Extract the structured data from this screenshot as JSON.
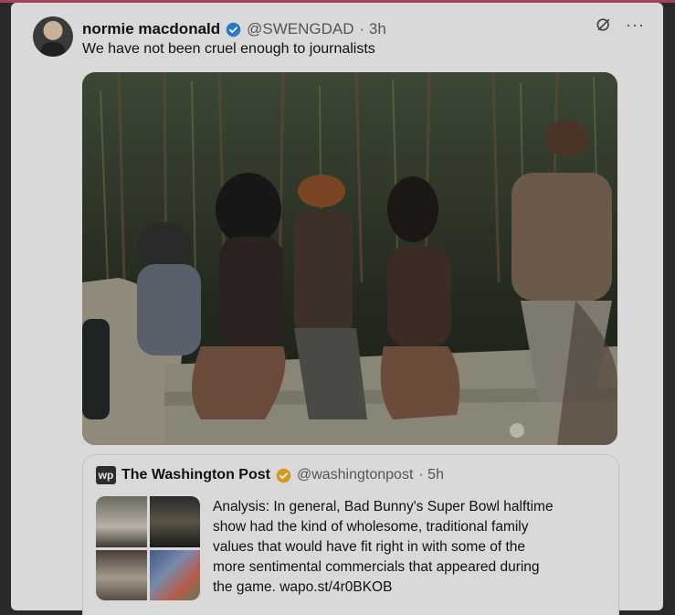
{
  "post": {
    "display_name": "normie macdonald",
    "handle": "@SWENGDAD",
    "time": "· 3h",
    "text": "We have not been cruel enough to journalists",
    "icons": [
      "verified-badge-icon",
      "grok-icon",
      "more-icon"
    ],
    "more": "···"
  },
  "quoted": {
    "logo": "wp",
    "name": "The Washington Post",
    "handle": "@washingtonpost",
    "time": "· 5h",
    "text": "Analysis: In general, Bad Bunny's Super Bowl halftime\nshow had the kind of wholesome, traditional family\nvalues that would have fit right in with some of the\nmore sentimental commercials that appeared during\nthe game. wapo.st/4r0BKOB"
  },
  "colors": {
    "card": "#d9d9d9",
    "verified_blue": "#2a78c8",
    "verified_gold": "#d49a22",
    "accent_strip": "#a2435a"
  }
}
